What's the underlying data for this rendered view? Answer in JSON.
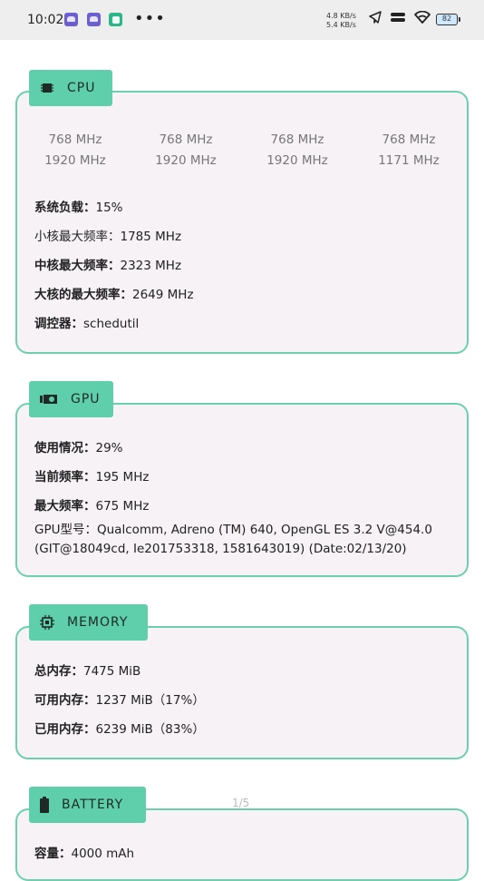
{
  "status_bar": {
    "time": "10:02",
    "more": "•••",
    "net_up": "4.8 KB/s",
    "net_down": "5.4 KB/s",
    "battery": "82"
  },
  "cpu": {
    "title": "CPU",
    "freqs": [
      {
        "min": "768 MHz",
        "max": "1920 MHz"
      },
      {
        "min": "768 MHz",
        "max": "1920 MHz"
      },
      {
        "min": "768 MHz",
        "max": "1920 MHz"
      },
      {
        "min": "768 MHz",
        "max": "1171 MHz"
      }
    ],
    "load_label": "系统负载：",
    "load_value": "15%",
    "little_label": "小核最大频率：",
    "little_value": "1785 MHz",
    "mid_label": "中核最大频率：",
    "mid_value": "2323 MHz",
    "big_label": "大核的最大频率：",
    "big_value": "2649 MHz",
    "governor_label": "调控器：",
    "governor_value": "schedutil"
  },
  "gpu": {
    "title": "GPU",
    "usage_label": "使用情况：",
    "usage_value": "29%",
    "cur_label": "当前频率：",
    "cur_value": "195 MHz",
    "max_label": "最大频率：",
    "max_value": "675 MHz",
    "model_label": "GPU型号：",
    "model_value": "Qualcomm, Adreno (TM) 640, OpenGL ES 3.2 V@454.0 (GIT@18049cd, Ie201753318, 1581643019) (Date:02/13/20)"
  },
  "memory": {
    "title": "MEMORY",
    "total_label": "总内存：",
    "total_value": "7475 MiB",
    "avail_label": "可用内存：",
    "avail_value": "1237 MiB（17%）",
    "used_label": "已用内存：",
    "used_value": "6239 MiB（83%）"
  },
  "battery": {
    "title": "BATTERY",
    "capacity_label": "容量：",
    "capacity_value": "4000 mAh"
  },
  "page_indicator": "1/5",
  "colors": {
    "accent": "#5ecfaa",
    "border": "#6ccfae",
    "card_bg": "#f6f2f6"
  }
}
